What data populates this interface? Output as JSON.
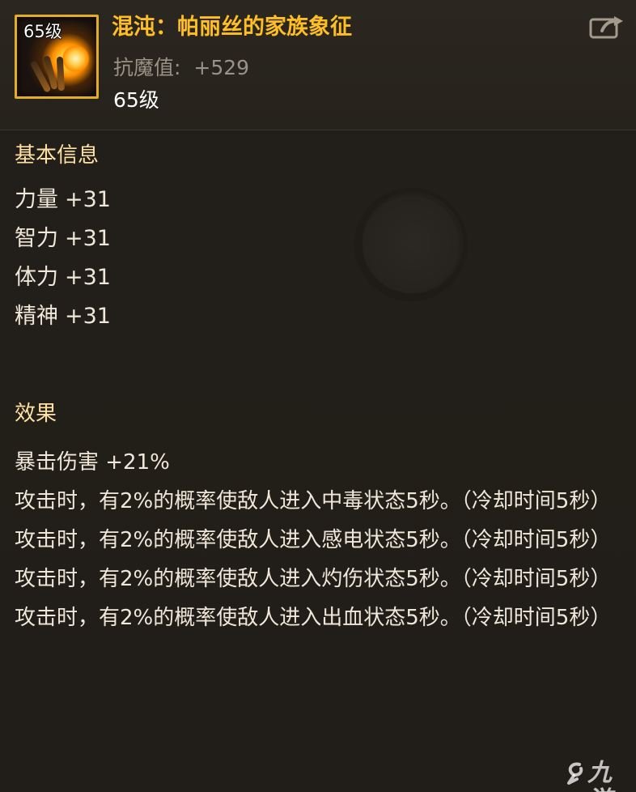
{
  "item": {
    "icon_level": "65级",
    "name": "混沌：帕丽丝的家族象征",
    "resistance_label": "抗魔值:",
    "resistance_value": "+529",
    "level_text": "65级",
    "share_icon": "share-icon"
  },
  "basic_info": {
    "title": "基本信息",
    "stats": [
      {
        "name": "力量",
        "value": "+31"
      },
      {
        "name": "智力",
        "value": "+31"
      },
      {
        "name": "体力",
        "value": "+31"
      },
      {
        "name": "精神",
        "value": "+31"
      }
    ]
  },
  "effects": {
    "title": "效果",
    "lines": [
      "暴击伤害 +21%",
      "攻击时，有2%的概率使敌人进入中毒状态5秒。（冷却时间5秒）",
      "攻击时，有2%的概率使敌人进入感电状态5秒。（冷却时间5秒）",
      "攻击时，有2%的概率使敌人进入灼伤状态5秒。（冷却时间5秒）",
      "攻击时，有2%的概率使敌人进入出血状态5秒。（冷却时间5秒）"
    ]
  },
  "watermark": {
    "text": "九游",
    "icon": "jiuyou-logo-icon"
  },
  "colors": {
    "title": "#ffbf24",
    "section": "#ffe2a3",
    "text": "#efe7d9",
    "muted": "#9a9286",
    "frame": "#e3ad24"
  }
}
